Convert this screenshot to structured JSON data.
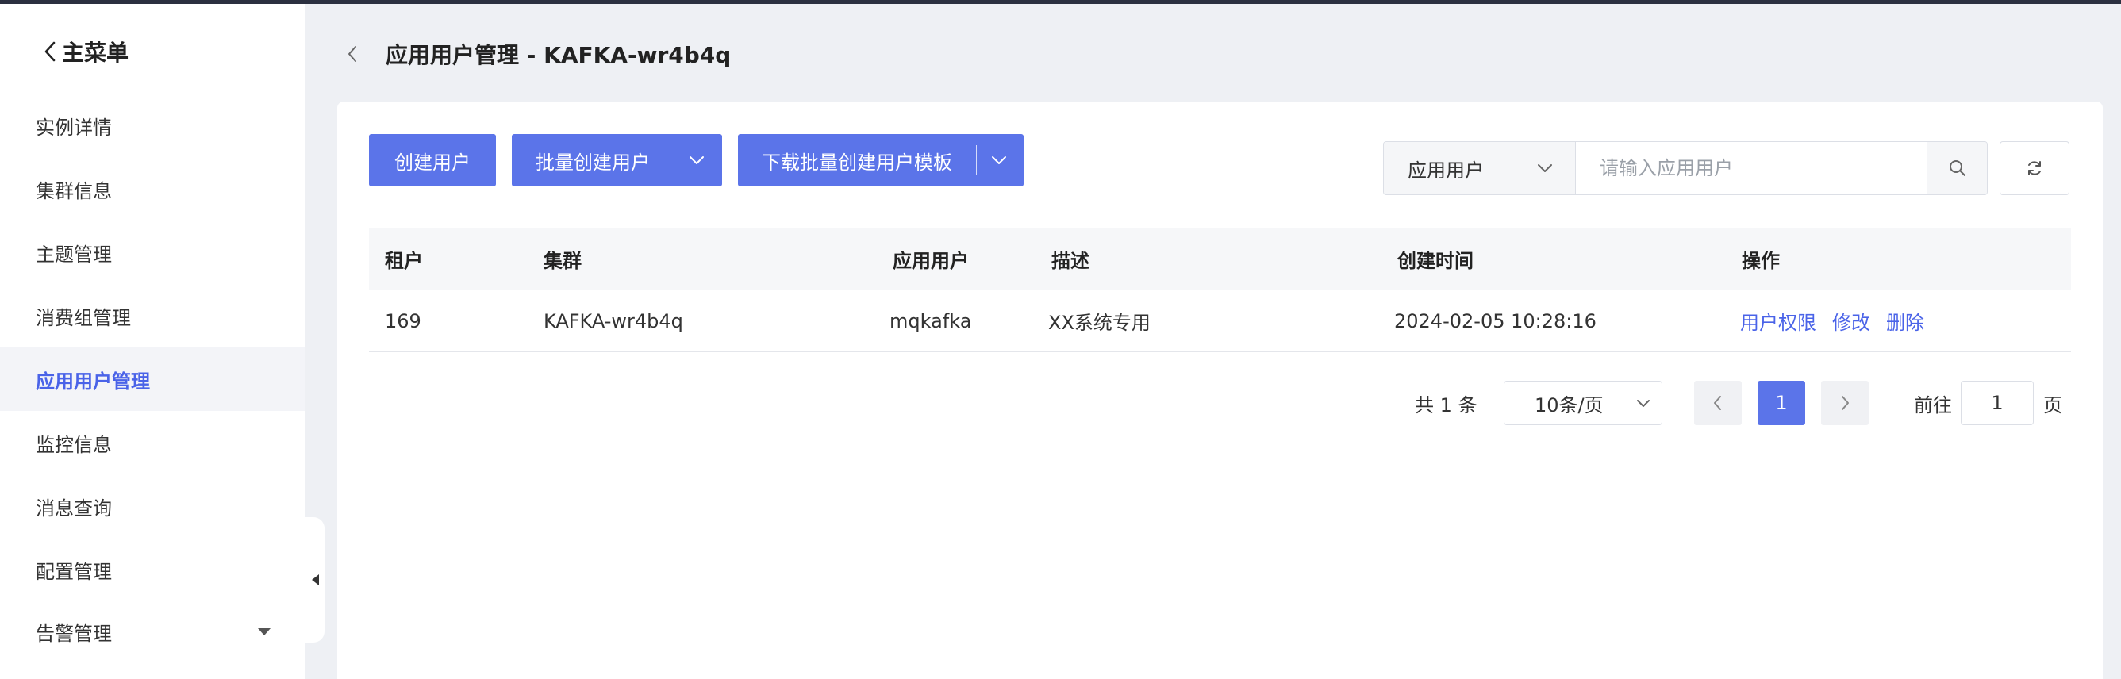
{
  "sidebar": {
    "back_label": "主菜单",
    "items": [
      {
        "label": "实例详情"
      },
      {
        "label": "集群信息"
      },
      {
        "label": "主题管理"
      },
      {
        "label": "消费组管理"
      },
      {
        "label": "应用用户管理",
        "active": true
      },
      {
        "label": "监控信息"
      },
      {
        "label": "消息查询"
      },
      {
        "label": "配置管理"
      },
      {
        "label": "告警管理",
        "expandable": true
      }
    ]
  },
  "header": {
    "title": "应用用户管理 - KAFKA-wr4b4q"
  },
  "toolbar": {
    "create_label": "创建用户",
    "batch_create_label": "批量创建用户",
    "download_template_label": "下载批量创建用户模板"
  },
  "search": {
    "type_label": "应用用户",
    "placeholder": "请输入应用用户"
  },
  "table": {
    "columns": [
      "租户",
      "集群",
      "应用用户",
      "描述",
      "创建时间",
      "操作"
    ],
    "rows": [
      {
        "tenant": "169",
        "cluster": "KAFKA-wr4b4q",
        "app_user": "mqkafka",
        "description": "XX系统专用",
        "created_at": "2024-02-05 10:28:16",
        "actions": [
          "用户权限",
          "修改",
          "删除"
        ]
      }
    ]
  },
  "pagination": {
    "total_text": "共 1 条",
    "page_size": "10条/页",
    "current_page": "1",
    "goto_prefix": "前往",
    "goto_value": "1",
    "goto_suffix": "页"
  },
  "colors": {
    "primary": "#5b74e9",
    "link": "#4a63e8",
    "topbar": "#2b3040",
    "page_bg": "#eef0f4"
  },
  "icons": [
    "chevron-left-icon",
    "chevron-down-icon",
    "search-icon",
    "refresh-icon",
    "caret-down-icon",
    "collapse-left-icon"
  ]
}
